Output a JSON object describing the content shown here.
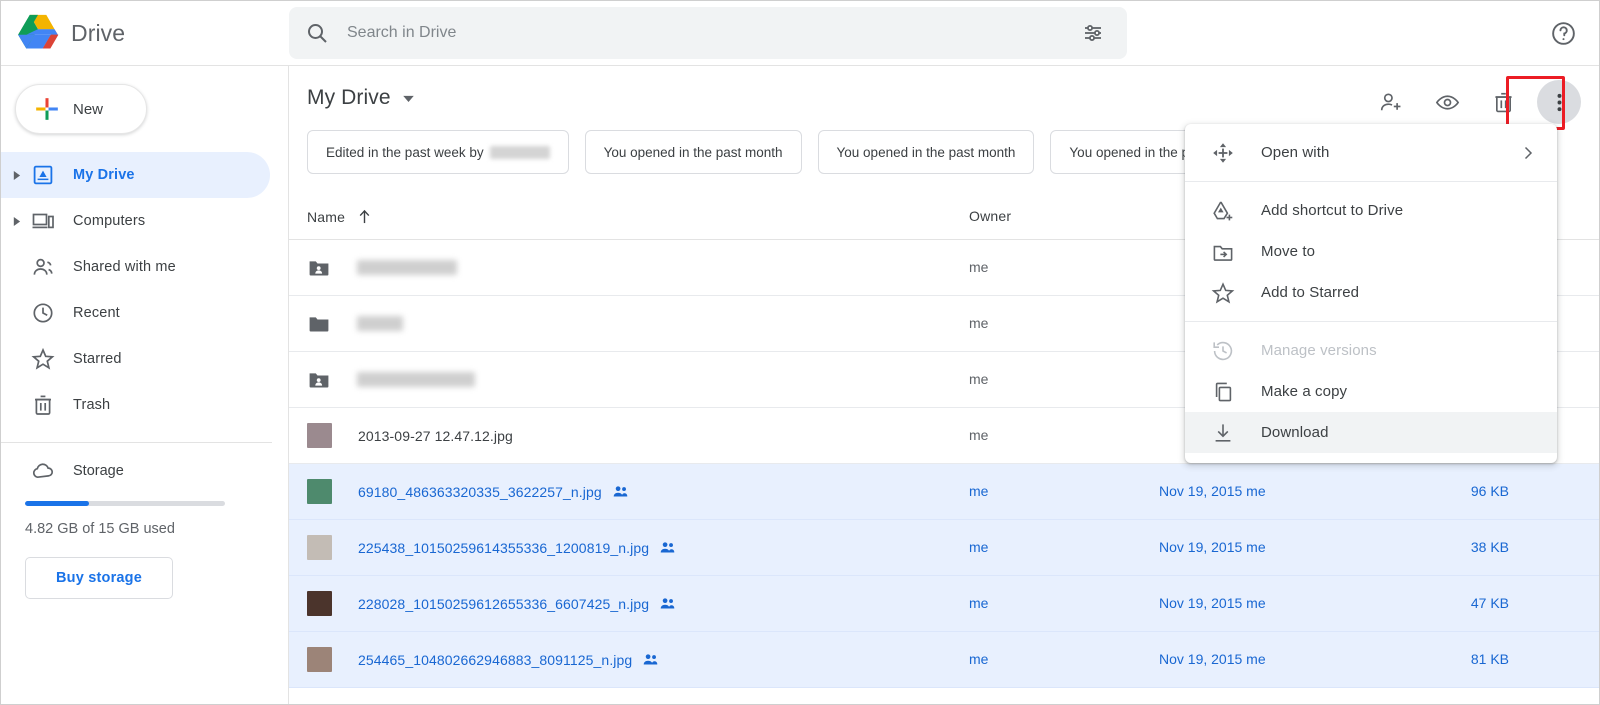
{
  "app": {
    "brand": "Drive",
    "logo_colors": {
      "blue": "#4285f4",
      "green": "#0f9d58",
      "yellow": "#f4b400",
      "red": "#db4437"
    },
    "accent": "#1a73e8",
    "selection_bg": "#e8f0fe",
    "highlight_color": "#ec1c24"
  },
  "search": {
    "placeholder": "Search in Drive",
    "value": "",
    "icon": "search-icon",
    "options_icon": "tune-icon"
  },
  "header": {
    "help_icon": "help-circle-icon"
  },
  "sidebar": {
    "new_button": "New",
    "items": [
      {
        "label": "My Drive",
        "icon": "my-drive-icon",
        "active": true,
        "expandable": true
      },
      {
        "label": "Computers",
        "icon": "computer-icon",
        "active": false,
        "expandable": true
      },
      {
        "label": "Shared with me",
        "icon": "people-icon",
        "active": false,
        "expandable": false
      },
      {
        "label": "Recent",
        "icon": "clock-icon",
        "active": false,
        "expandable": false
      },
      {
        "label": "Starred",
        "icon": "star-icon",
        "active": false,
        "expandable": false
      },
      {
        "label": "Trash",
        "icon": "trash-icon",
        "active": false,
        "expandable": false
      }
    ],
    "storage": {
      "label": "Storage",
      "icon": "cloud-icon",
      "used_text": "4.82 GB of 15 GB used",
      "percent": 32,
      "buy_button": "Buy storage"
    }
  },
  "main": {
    "breadcrumb": "My Drive",
    "toolbar": [
      {
        "name": "share-icon",
        "label": "Share"
      },
      {
        "name": "eye-icon",
        "label": "Preview"
      },
      {
        "name": "trash-icon",
        "label": "Remove"
      },
      {
        "name": "more-vertical-icon",
        "label": "More actions",
        "highlighted": true
      }
    ],
    "chips": [
      {
        "text": "Edited in the past week by",
        "redacted": true
      },
      {
        "text": "You opened in the past month",
        "redacted": false
      },
      {
        "text": "You opened in the past month",
        "redacted": false
      },
      {
        "text": "You opened in the past month",
        "redacted": false
      }
    ],
    "columns": {
      "name": "Name",
      "owner": "Owner",
      "sort_direction": "ascending"
    },
    "rows": [
      {
        "name": "",
        "redacted": true,
        "redacted_width": 100,
        "icon": "shared-folder-icon",
        "owner": "me",
        "modified": "",
        "size": "",
        "selected": false,
        "shared": false
      },
      {
        "name": "",
        "redacted": true,
        "redacted_width": 46,
        "icon": "folder-icon",
        "owner": "me",
        "modified": "",
        "size": "",
        "selected": false,
        "shared": false
      },
      {
        "name": "",
        "redacted": true,
        "redacted_width": 118,
        "icon": "shared-folder-icon",
        "owner": "me",
        "modified": "",
        "size": "",
        "selected": false,
        "shared": false
      },
      {
        "name": "2013-09-27 12.47.12.jpg",
        "redacted": false,
        "icon": "image-thumbnail",
        "thumb": "#9b8a8f",
        "owner": "me",
        "modified": "",
        "size": "",
        "selected": false,
        "shared": false
      },
      {
        "name": "69180_486363320335_3622257_n.jpg",
        "redacted": false,
        "icon": "image-thumbnail",
        "thumb": "#4e8a6d",
        "owner": "me",
        "modified": "Nov 19, 2015 me",
        "size": "96 KB",
        "selected": true,
        "shared": true
      },
      {
        "name": "225438_10150259614355336_1200819_n.jpg",
        "redacted": false,
        "icon": "image-thumbnail",
        "thumb": "#c3bcb5",
        "owner": "me",
        "modified": "Nov 19, 2015 me",
        "size": "38 KB",
        "selected": true,
        "shared": true
      },
      {
        "name": "228028_10150259612655336_6607425_n.jpg",
        "redacted": false,
        "icon": "image-thumbnail",
        "thumb": "#4b342c",
        "owner": "me",
        "modified": "Nov 19, 2015 me",
        "size": "47 KB",
        "selected": true,
        "shared": true
      },
      {
        "name": "254465_104802662946883_8091125_n.jpg",
        "redacted": false,
        "icon": "image-thumbnail",
        "thumb": "#9c8478",
        "owner": "me",
        "modified": "Nov 19, 2015 me",
        "size": "81 KB",
        "selected": true,
        "shared": true
      }
    ]
  },
  "context_menu": {
    "items": [
      {
        "label": "Open with",
        "icon": "open-with-arrows-icon",
        "has_submenu": true,
        "disabled": false,
        "highlighted": false
      },
      {
        "label": "Add shortcut to Drive",
        "icon": "add-shortcut-icon",
        "has_submenu": false,
        "disabled": false,
        "highlighted": false
      },
      {
        "label": "Move to",
        "icon": "move-to-folder-icon",
        "has_submenu": false,
        "disabled": false,
        "highlighted": false
      },
      {
        "label": "Add to Starred",
        "icon": "star-icon",
        "has_submenu": false,
        "disabled": false,
        "highlighted": false
      },
      {
        "label": "Manage versions",
        "icon": "history-icon",
        "has_submenu": false,
        "disabled": true,
        "highlighted": false
      },
      {
        "label": "Make a copy",
        "icon": "copy-icon",
        "has_submenu": false,
        "disabled": false,
        "highlighted": false
      },
      {
        "label": "Download",
        "icon": "download-icon",
        "has_submenu": false,
        "disabled": false,
        "highlighted": true
      }
    ]
  }
}
